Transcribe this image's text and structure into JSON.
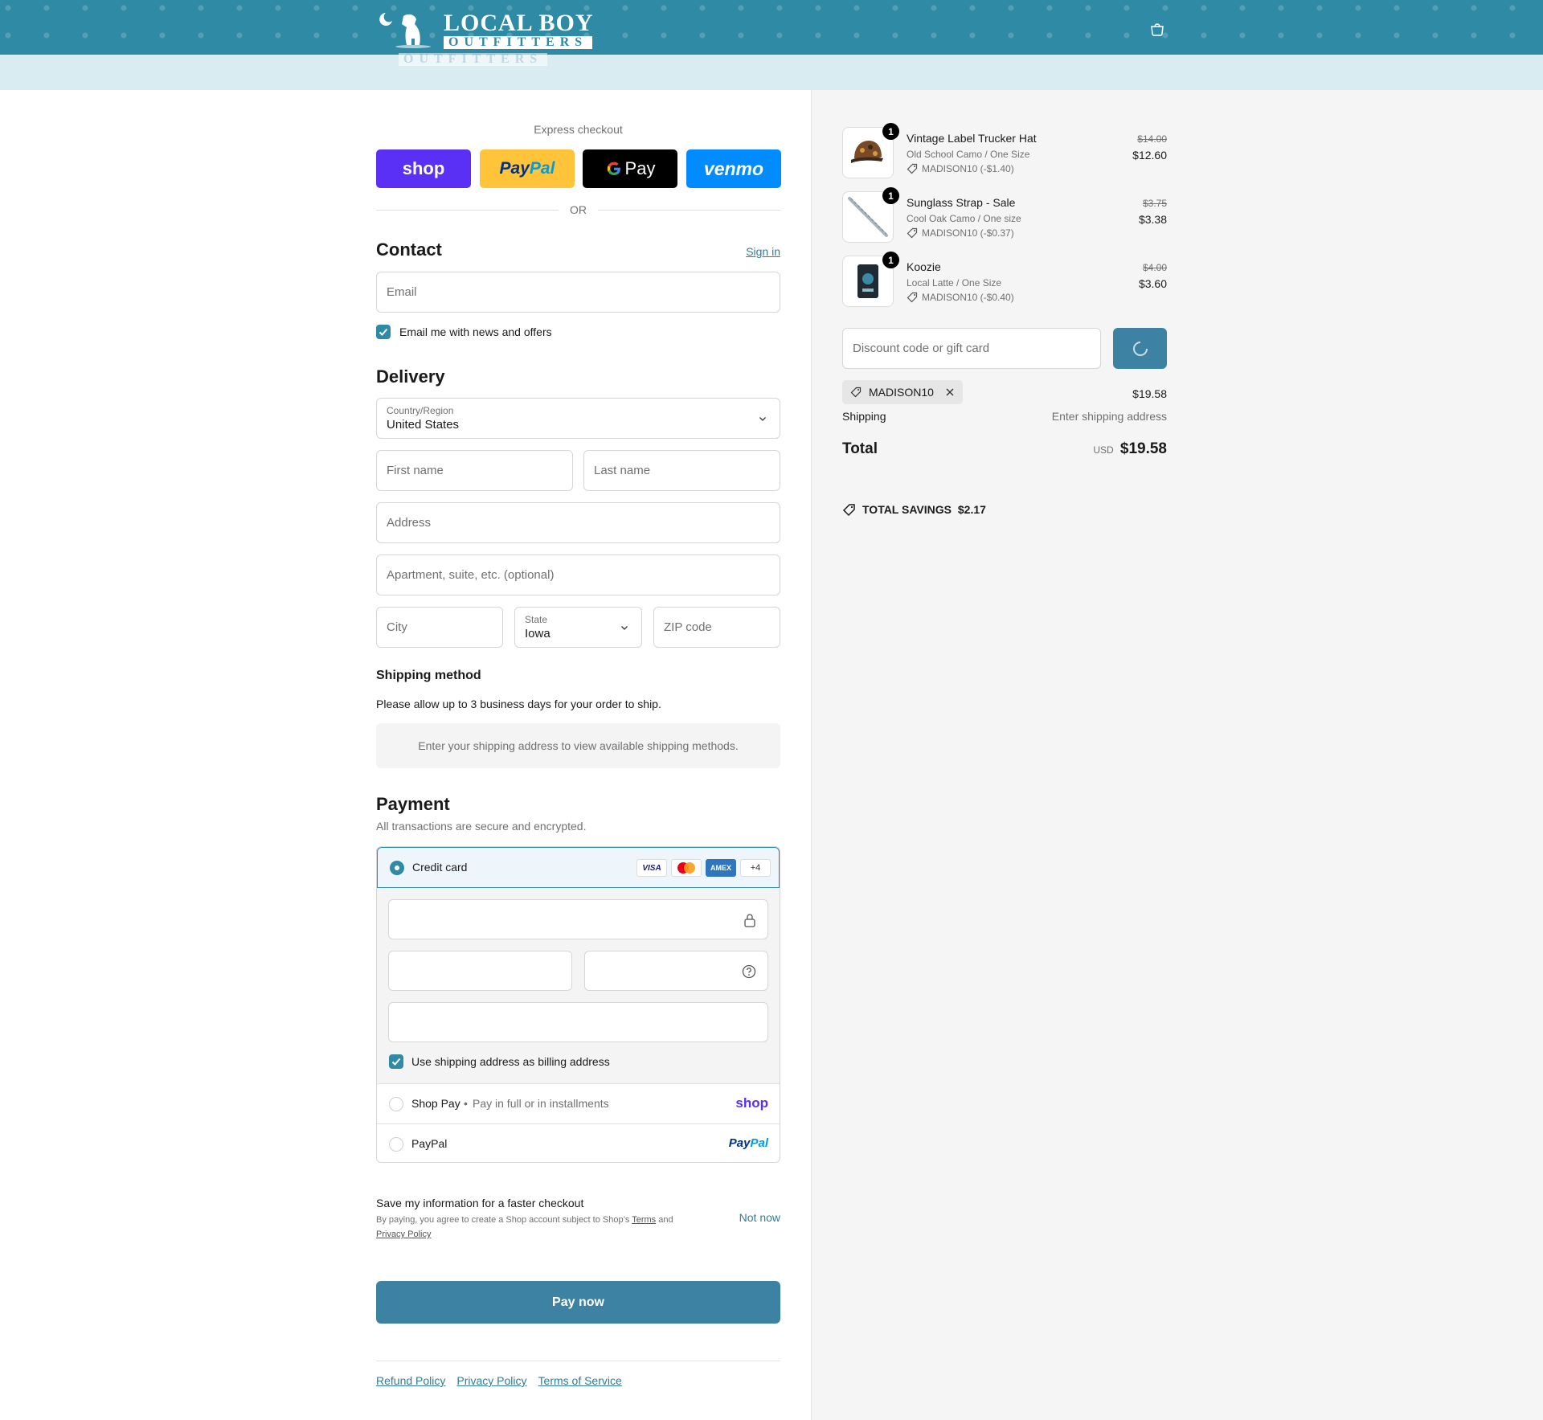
{
  "header": {
    "logo_top": "LOCAL BOY",
    "logo_bottom": "OUTFITTERS",
    "cart_icon": "cart-icon",
    "brand_color": "#2f8aa6"
  },
  "express": {
    "title": "Express checkout",
    "shop_label": "shop",
    "paypal_label_1": "Pay",
    "paypal_label_2": "Pal",
    "gpay_label": "Pay",
    "venmo_label": "venmo",
    "or_label": "OR"
  },
  "contact": {
    "title": "Contact",
    "sign_in": "Sign in",
    "email_placeholder": "Email",
    "newsletter_label": "Email me with news and offers",
    "newsletter_checked": true
  },
  "delivery": {
    "title": "Delivery",
    "country_label": "Country/Region",
    "country_value": "United States",
    "first_name_placeholder": "First name",
    "last_name_placeholder": "Last name",
    "address_placeholder": "Address",
    "apartment_placeholder": "Apartment, suite, etc. (optional)",
    "city_placeholder": "City",
    "state_label": "State",
    "state_value": "Iowa",
    "zip_placeholder": "ZIP code"
  },
  "shipping_method": {
    "title": "Shipping method",
    "note": "Please allow up to 3 business days for your order to ship.",
    "placeholder": "Enter your shipping address to view available shipping methods."
  },
  "payment": {
    "title": "Payment",
    "subtitle": "All transactions are secure and encrypted.",
    "credit_card_label": "Credit card",
    "card_brands": [
      "VISA",
      "mastercard",
      "AMEX",
      "+4"
    ],
    "billing_label": "Use shipping address as billing address",
    "billing_checked": true,
    "shop_pay_label": "Shop Pay",
    "shop_pay_note": "Pay in full or in installments",
    "shop_pay_logo": "shop",
    "paypal_label": "PayPal",
    "paypal_logo_1": "Pay",
    "paypal_logo_2": "Pal"
  },
  "save_info": {
    "title": "Save my information for a faster checkout",
    "fine_print_1": "By paying, you agree to create a Shop account subject to Shop’s",
    "terms": "Terms",
    "and": "and",
    "privacy": "Privacy Policy",
    "not_now": "Not now"
  },
  "pay_button": "Pay now",
  "footer": {
    "links": [
      "Refund Policy",
      "Privacy Policy",
      "Terms of Service"
    ]
  },
  "summary": {
    "items": [
      {
        "qty": "1",
        "name": "Vintage Label Trucker Hat",
        "variant": "Old School Camo / One Size",
        "discount": "MADISON10 (-$1.40)",
        "old_price": "$14.00",
        "price": "$12.60"
      },
      {
        "qty": "1",
        "name": "Sunglass Strap - Sale",
        "variant": "Cool Oak Camo / One size",
        "discount": "MADISON10 (-$0.37)",
        "old_price": "$3.75",
        "price": "$3.38"
      },
      {
        "qty": "1",
        "name": "Koozie",
        "variant": "Local Latte / One Size",
        "discount": "MADISON10 (-$0.40)",
        "old_price": "$4.00",
        "price": "$3.60"
      }
    ],
    "discount_placeholder": "Discount code or gift card",
    "applied_code": "MADISON10",
    "subtotal_value": "$19.58",
    "shipping_label": "Shipping",
    "shipping_value": "Enter shipping address",
    "total_label": "Total",
    "currency": "USD",
    "total_value": "$19.58",
    "savings_label": "TOTAL SAVINGS",
    "savings_value": "$2.17"
  }
}
